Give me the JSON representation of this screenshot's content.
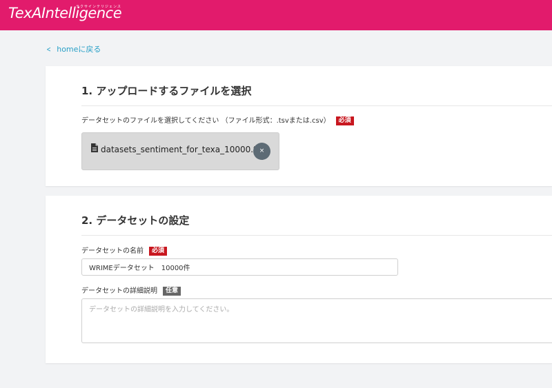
{
  "header": {
    "logo_text": "TexAIntelligence",
    "logo_subtext": "テクサインテリジェンス",
    "background": "#e21b6c"
  },
  "nav": {
    "back_label": "homeに戻る",
    "back_icon": "chevron-left-icon"
  },
  "upload_section": {
    "title": "1. アップロードするファイルを選択",
    "field_label": "データセットのファイルを選択してください （ファイル形式：.tsvまたは.csv）",
    "required_badge": "必須",
    "file": {
      "icon": "document-icon",
      "name": "datasets_sentiment_for_texa_10000.tsv",
      "remove_label": "×"
    }
  },
  "settings_section": {
    "title": "2. データセットの設定",
    "name_label": "データセットの名前",
    "name_badge": "必須",
    "name_value": "WRIMEデータセット　10000件",
    "description_label": "データセットの詳細説明",
    "description_badge": "任意",
    "description_placeholder": "データセットの詳細説明を入力してください。"
  },
  "colors": {
    "accent": "#e21b6c",
    "link": "#2aa0c7",
    "required": "#c8171f",
    "optional": "#666666"
  }
}
